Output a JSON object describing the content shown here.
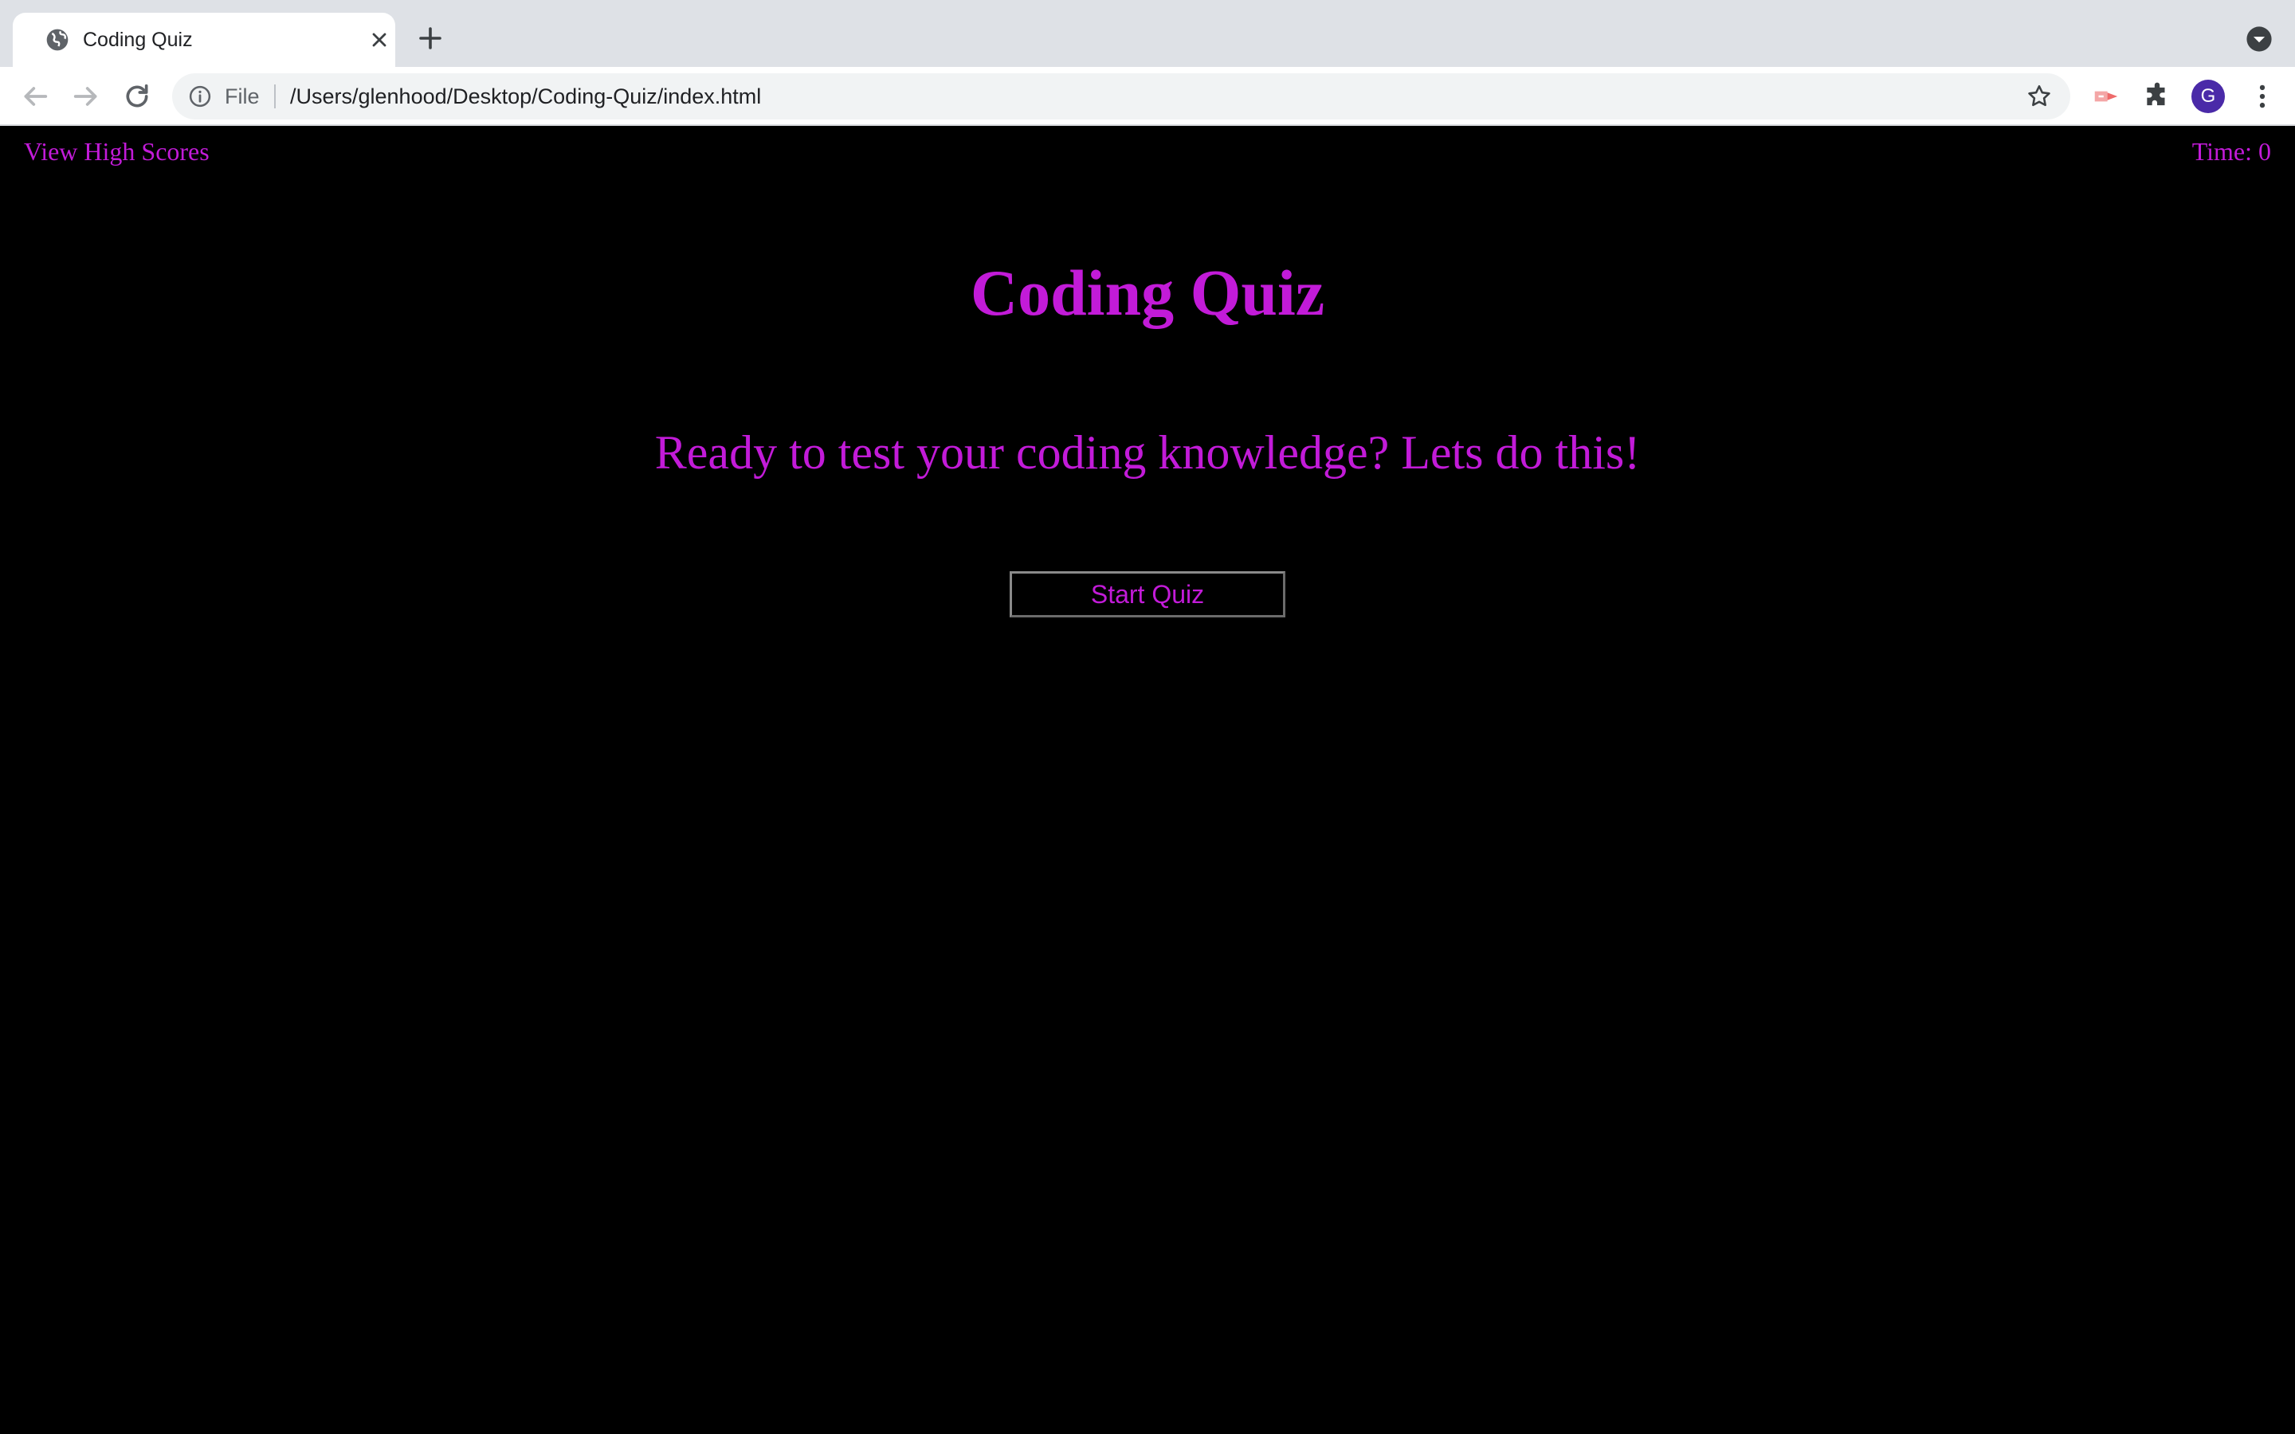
{
  "browser": {
    "tab": {
      "title": "Coding Quiz",
      "favicon": "globe-icon"
    },
    "omnibox": {
      "scheme_label": "File",
      "url": "/Users/glenhood/Desktop/Coding-Quiz/index.html"
    },
    "profile_initial": "G",
    "colors": {
      "tabstrip": "#dee1e6",
      "omnibox": "#f1f3f4",
      "avatar": "#4a2aa8"
    }
  },
  "header": {
    "highscores_link": "View High Scores",
    "timer_text": "Time: 0"
  },
  "main": {
    "title": "Coding Quiz",
    "intro": "Ready to test your coding knowledge? Lets do this!",
    "start_button": "Start Quiz"
  },
  "theme": {
    "background": "#000000",
    "accent": "#c21bd8"
  }
}
